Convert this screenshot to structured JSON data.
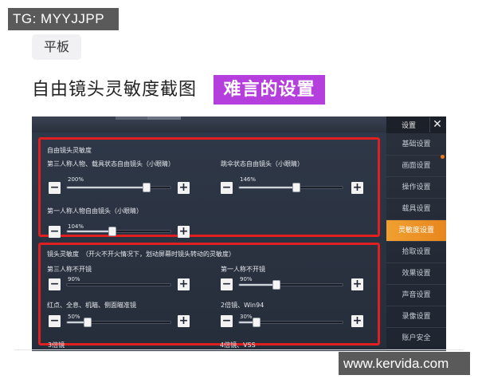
{
  "watermark_top": "TG: MYYJJPP",
  "watermark_bottom": "www.kervida.com",
  "tag": "平板",
  "headline": "自由镜头灵敏度截图",
  "highlight": "难言的设置",
  "colors": {
    "highlight_bg": "#b43fdc",
    "section_border": "#e02020",
    "active_tab": "#f0a030",
    "panel_bg": "#2f3848"
  },
  "screenshot": {
    "sidebar": {
      "title": "设置",
      "close_icon": "close-icon",
      "items": [
        {
          "label": "基础设置",
          "active": false
        },
        {
          "label": "画面设置",
          "active": false
        },
        {
          "label": "操作设置",
          "active": false
        },
        {
          "label": "载具设置",
          "active": false
        },
        {
          "label": "灵敏度设置",
          "active": true
        },
        {
          "label": "拾取设置",
          "active": false
        },
        {
          "label": "效果设置",
          "active": false
        },
        {
          "label": "声音设置",
          "active": false
        },
        {
          "label": "录像设置",
          "active": false
        },
        {
          "label": "账户安全",
          "active": false
        }
      ]
    },
    "section1": {
      "title": "自由镜头灵敏度",
      "sliders": [
        {
          "label": "第三人称人物、载具状态自由镜头（小眼睛）",
          "value": "200%",
          "fraction": 0.77
        },
        {
          "label": "跳伞状态自由镜头（小眼睛）",
          "value": "146%",
          "fraction": 0.55
        },
        {
          "label": "第一人称人物自由镜头（小眼睛）",
          "value": "104%",
          "fraction": 0.44
        }
      ]
    },
    "section2": {
      "title": "镜头灵敏度　（开火不开火情况下，划动屏幕时镜头转动的灵敏度）",
      "sliders": [
        {
          "label": "第三人称不开镜",
          "value": "90%",
          "fraction": 0.0
        },
        {
          "label": "第一人称不开镜",
          "value": "90%",
          "fraction": 0.36
        },
        {
          "label": "红点、全息、机瞄、侧面瞄准镜",
          "value": "50%",
          "fraction": 0.2
        },
        {
          "label": "2倍镜、Win94",
          "value": "30%",
          "fraction": 0.17
        }
      ]
    },
    "footer_labels": [
      "3倍镜",
      "4倍镜、VSS"
    ]
  }
}
